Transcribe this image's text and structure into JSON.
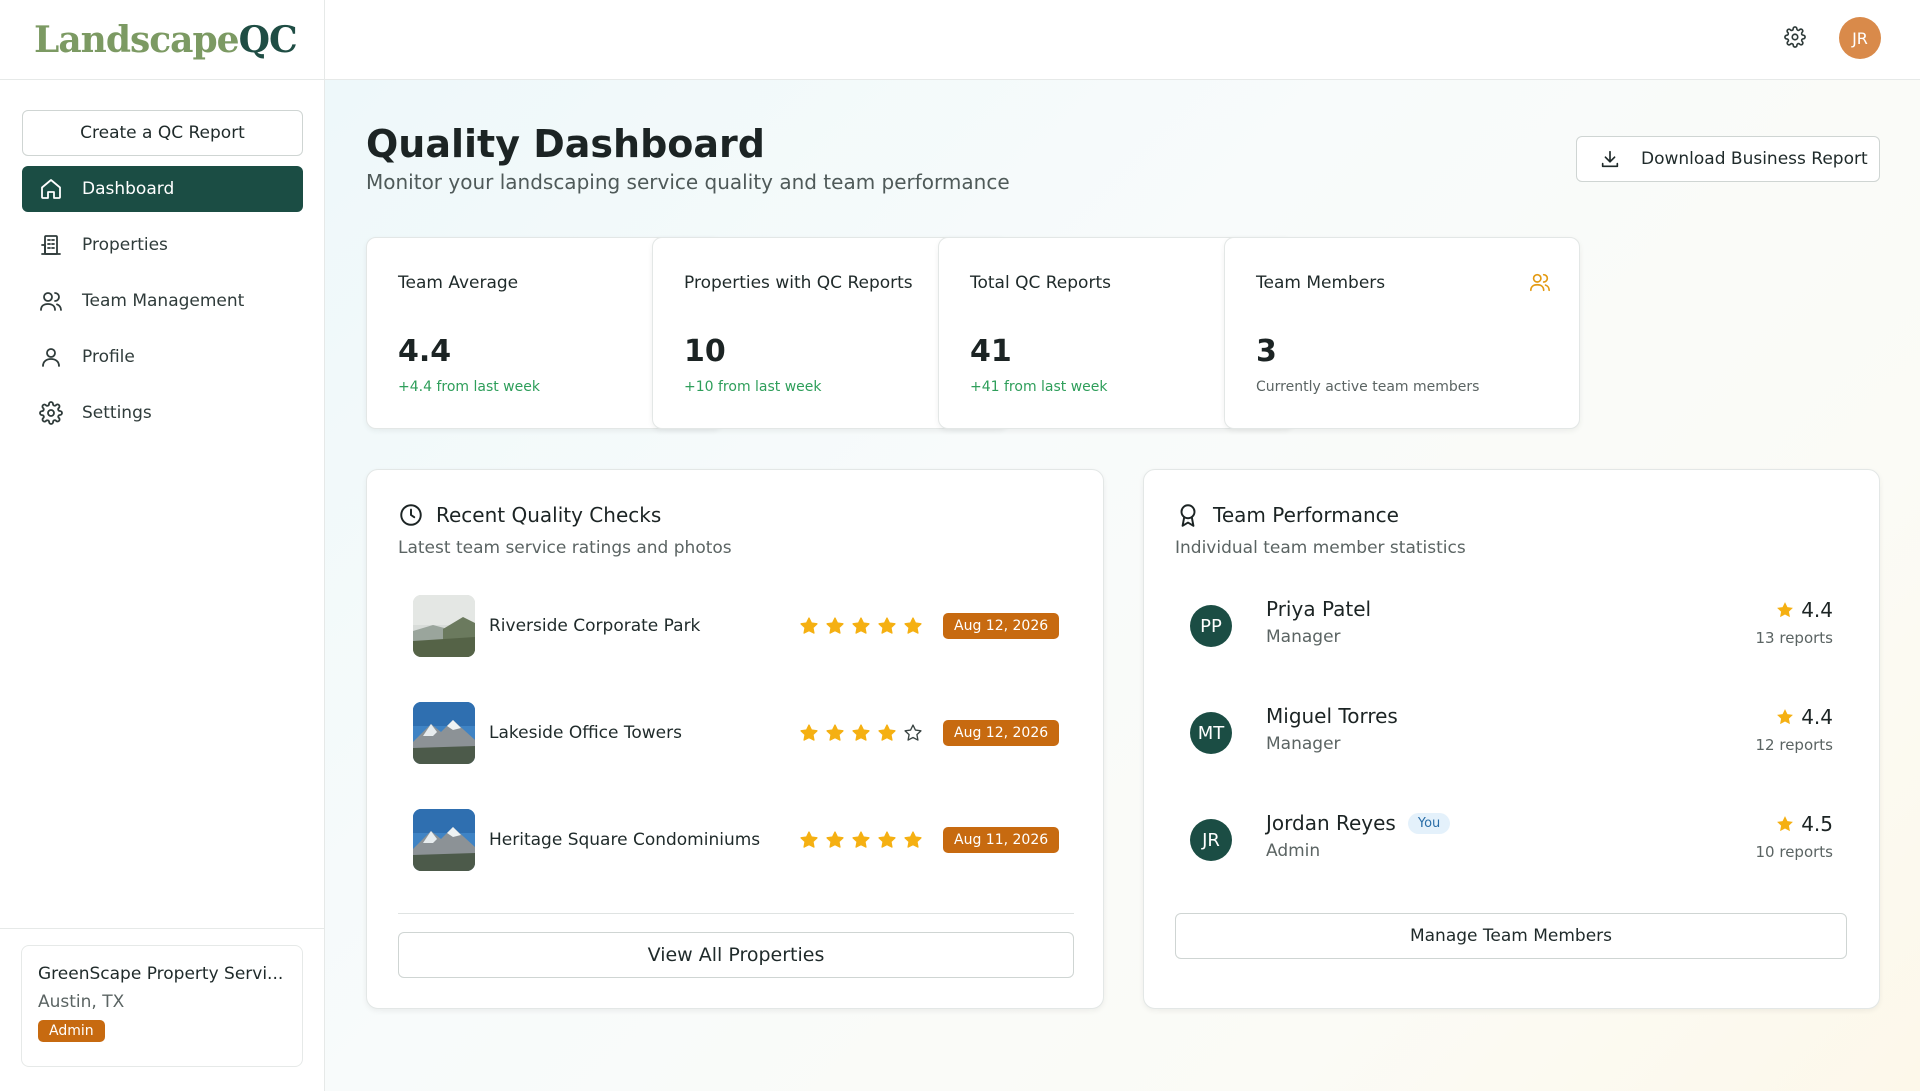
{
  "brand": {
    "logo_main": "Landscape",
    "logo_qc": "QC"
  },
  "sidebar": {
    "create_label": "Create a QC Report",
    "items": [
      {
        "label": "Dashboard",
        "icon": "home-icon",
        "active": true
      },
      {
        "label": "Properties",
        "icon": "building-icon"
      },
      {
        "label": "Team Management",
        "icon": "users-icon"
      },
      {
        "label": "Profile",
        "icon": "user-icon"
      },
      {
        "label": "Settings",
        "icon": "gear-icon"
      }
    ],
    "org": {
      "name": "GreenScape Property Servi...",
      "location": "Austin, TX",
      "role": "Admin"
    }
  },
  "topbar": {
    "avatar_initials": "JR"
  },
  "page": {
    "title": "Quality Dashboard",
    "subtitle": "Monitor your landscaping service quality and team performance",
    "download_label": "Download Business Report"
  },
  "stats": [
    {
      "label": "Team Average",
      "value": "4.4",
      "note": "+4.4 from last week",
      "icon": "star-icon"
    },
    {
      "label": "Properties with QC Reports",
      "value": "10",
      "note": "+10 from last week",
      "icon": "map-pin-icon"
    },
    {
      "label": "Total QC Reports",
      "value": "41",
      "note": "+41 from last week",
      "icon": "map-pin-icon"
    },
    {
      "label": "Team Members",
      "value": "3",
      "note": "Currently active team members",
      "icon": "users-icon"
    }
  ],
  "recent": {
    "title": "Recent Quality Checks",
    "subtitle": "Latest team service ratings and photos",
    "rows": [
      {
        "name": "Riverside Corporate Park",
        "rating": 5,
        "date": "Aug 12, 2026"
      },
      {
        "name": "Lakeside Office Towers",
        "rating": 4,
        "date": "Aug 12, 2026"
      },
      {
        "name": "Heritage Square Condominiums",
        "rating": 5,
        "date": "Aug 11, 2026"
      }
    ],
    "view_all_label": "View All Properties"
  },
  "team": {
    "title": "Team Performance",
    "subtitle": "Individual team member statistics",
    "members": [
      {
        "initials": "PP",
        "name": "Priya Patel",
        "role": "Manager",
        "rating": "4.4",
        "reports": "13 reports",
        "you": ""
      },
      {
        "initials": "MT",
        "name": "Miguel Torres",
        "role": "Manager",
        "rating": "4.4",
        "reports": "12 reports",
        "you": ""
      },
      {
        "initials": "JR",
        "name": "Jordan Reyes",
        "role": "Admin",
        "rating": "4.5",
        "reports": "10 reports",
        "you": "You"
      }
    ],
    "manage_label": "Manage Team Members"
  },
  "colors": {
    "brand_dark": "#1b4d44",
    "brand_green": "#7c9a63",
    "accent_orange": "#c76a10",
    "star_gold": "#f5b012",
    "positive_green": "#2e9e5a"
  }
}
